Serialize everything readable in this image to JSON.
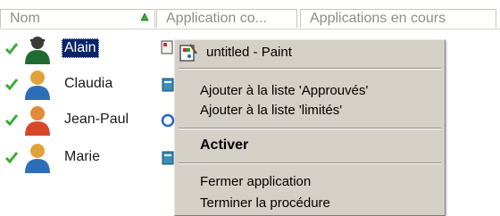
{
  "columns": {
    "name": "Nom",
    "application": "Application co...",
    "running": "Applications en cours"
  },
  "users": [
    {
      "name": "Alain",
      "selected": true,
      "status": "online-check-icon"
    },
    {
      "name": "Claudia",
      "selected": false,
      "status": "online-check-icon"
    },
    {
      "name": "Jean-Paul",
      "selected": false,
      "status": "online-check-icon"
    },
    {
      "name": "Marie",
      "selected": false,
      "status": "online-check-icon"
    }
  ],
  "context_menu": {
    "title": "untitled - Paint",
    "items": [
      "Ajouter à la liste 'Approuvés'",
      "Ajouter à la liste 'limités'",
      "Activer",
      "Fermer application",
      "Terminer la procédure"
    ]
  },
  "colors": {
    "selection": "#0a246a",
    "menu_bg": "#d4d0c8",
    "check": "#3aaa35",
    "sort_arrow": "#3aaa35"
  }
}
